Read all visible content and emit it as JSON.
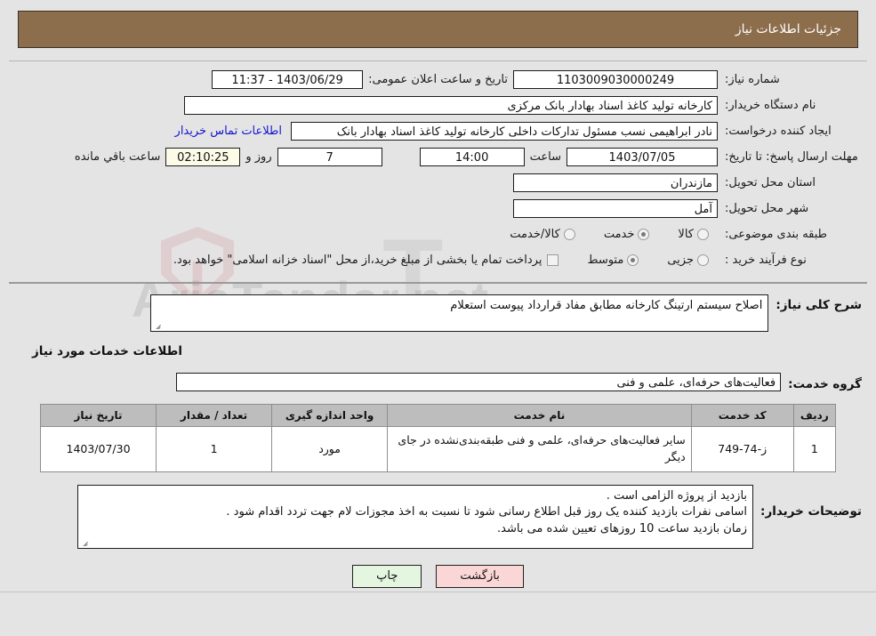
{
  "header": {
    "title": "جزئیات اطلاعات نیاز"
  },
  "form": {
    "need_number_label": "شماره نیاز:",
    "need_number_value": "1103009030000249",
    "announce_label": "تاریخ و ساعت اعلان عمومی:",
    "announce_value": "1403/06/29 - 11:37",
    "buyer_org_label": "نام دستگاه خریدار:",
    "buyer_org_value": "کارخانه تولید کاغذ اسناد بهادار بانک مرکزی",
    "creator_label": "ایجاد کننده درخواست:",
    "creator_value": "نادر ابراهیمی نسب مسئول تدارکات داخلی کارخانه تولید کاغذ اسناد بهادار بانک",
    "contact_link": "اطلاعات تماس خریدار",
    "deadline_label": "مهلت ارسال پاسخ: تا تاریخ:",
    "deadline_date": "1403/07/05",
    "hour_label": "ساعت",
    "deadline_time": "14:00",
    "days_value": "7",
    "days_label": "روز و",
    "timer_value": "02:10:25",
    "remaining_label": "ساعت باقي مانده",
    "province_label": "استان محل تحویل:",
    "province_value": "مازندران",
    "city_label": "شهر محل تحویل:",
    "city_value": "آمل",
    "category_label": "طبقه بندی موضوعی:",
    "category_options": [
      {
        "label": "کالا",
        "selected": false
      },
      {
        "label": "خدمت",
        "selected": true
      },
      {
        "label": "کالا/خدمت",
        "selected": false
      }
    ],
    "process_label": "نوع فرآیند خرید :",
    "process_options": [
      {
        "label": "جزیی",
        "selected": false
      },
      {
        "label": "متوسط",
        "selected": true
      }
    ],
    "payment_checkbox_checked": false,
    "payment_note": "پرداخت تمام یا بخشی از مبلغ خرید،از محل \"اسناد خزانه اسلامی\" خواهد بود."
  },
  "details": {
    "need_desc_label": "شرح کلی نیاز:",
    "need_desc_value": "اصلاح سیستم ارتینگ کارخانه مطابق مفاد قرارداد پیوست استعلام",
    "services_section_title": "اطلاعات خدمات مورد نیاز",
    "service_group_label": "گروه خدمت:",
    "service_group_value": "فعالیت‌های حرفه‌ای، علمی و فنی"
  },
  "table": {
    "columns": [
      "ردیف",
      "کد خدمت",
      "نام خدمت",
      "واحد اندازه گیری",
      "تعداد / مقدار",
      "تاریخ نیاز"
    ],
    "rows": [
      {
        "radif": "1",
        "code": "ز-74-749",
        "name": "سایر فعالیت‌های حرفه‌ای، علمی و فنی طبقه‌بندی‌نشده در جای دیگر",
        "unit": "مورد",
        "qty": "1",
        "date": "1403/07/30"
      }
    ]
  },
  "notes": {
    "label": "توضیحات خریدار:",
    "lines": [
      "بازدید از پروژه الزامی است .",
      "اسامی نفرات بازدید کننده یک روز قبل اطلاع رسانی شود تا نسبت به اخذ مجوزات لام جهت تردد اقدام شود .",
      "زمان بازدید ساعت 10 روزهای تعیین شده می باشد."
    ]
  },
  "footer": {
    "print_label": "چاپ",
    "back_label": "بازگشت"
  },
  "watermark": {
    "text": "AriaTender.net",
    "letter": "T"
  },
  "colors": {
    "header_bg": "#8d6e4c",
    "page_bg": "#e4e4e4",
    "link": "#1414d2",
    "timer_bg": "#fbfbe7",
    "back_btn": "#fbd6d6",
    "print_btn": "#e4f5e0",
    "table_header": "#bdbdbd"
  }
}
